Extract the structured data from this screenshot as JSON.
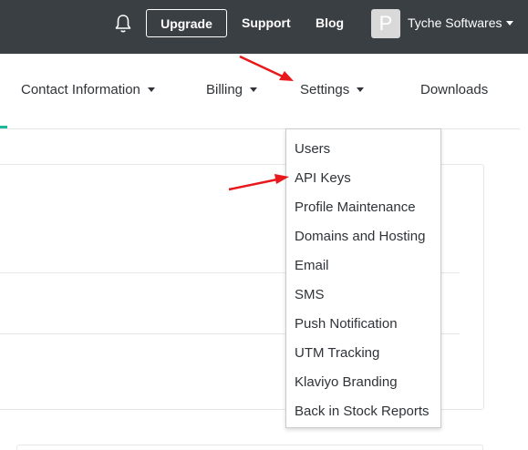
{
  "topbar": {
    "upgrade_label": "Upgrade",
    "support_label": "Support",
    "blog_label": "Blog",
    "avatar_initial": "P",
    "account_name": "Tyche Softwares"
  },
  "subnav": {
    "items": [
      {
        "label": "Contact Information",
        "has_caret": true
      },
      {
        "label": "Billing",
        "has_caret": true
      },
      {
        "label": "Settings",
        "has_caret": true
      },
      {
        "label": "Downloads",
        "has_caret": false
      }
    ]
  },
  "settings_menu": {
    "items": [
      "Users",
      "API Keys",
      "Profile Maintenance",
      "Domains and Hosting",
      "Email",
      "SMS",
      "Push Notification",
      "UTM Tracking",
      "Klaviyo Branding",
      "Back in Stock Reports"
    ]
  },
  "colors": {
    "topbar_bg": "#3a3f43",
    "active_accent": "#1fb89a",
    "annotation_arrow": "#e8191c"
  },
  "icons": [
    "bell-icon",
    "caret-down-icon"
  ]
}
